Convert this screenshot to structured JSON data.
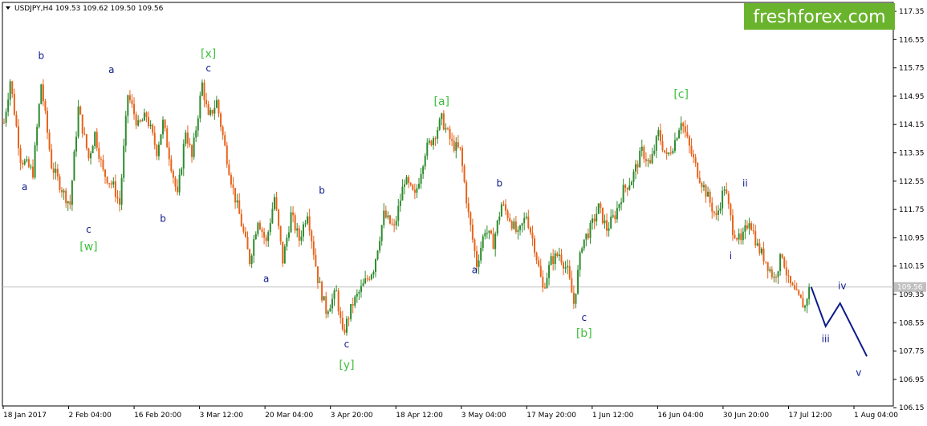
{
  "chart_data": {
    "type": "candlestick",
    "symbol_header": "USDJPY,H4  109.53 109.62 109.50 109.56",
    "current_price": 109.56,
    "current_price_label": "109.56",
    "ylim": [
      106.2,
      117.6
    ],
    "y_ticks": [
      "117.35",
      "116.55",
      "115.75",
      "114.95",
      "114.15",
      "113.35",
      "112.55",
      "111.75",
      "110.95",
      "110.15",
      "109.35",
      "108.55",
      "107.75",
      "106.95",
      "106.15"
    ],
    "x_ticks": [
      "18 Jan 2017",
      "2 Feb 04:00",
      "16 Feb 20:00",
      "3 Mar 12:00",
      "20 Mar 04:00",
      "3 Apr 20:00",
      "18 Apr 12:00",
      "3 May 04:00",
      "17 May 20:00",
      "1 Jun 12:00",
      "16 Jun 04:00",
      "30 Jun 20:00",
      "17 Jul 12:00",
      "1 Aug 04:00"
    ],
    "colors": {
      "up": "#2e8b2e",
      "down": "#e8631a",
      "wave_blue": "#0d1a8a",
      "wave_green": "#3fbf3f",
      "price_line": "#c0c0c0",
      "logo_bg": "#6ab42d"
    },
    "price_path": [
      [
        0,
        114.2
      ],
      [
        3,
        115.4
      ],
      [
        8,
        113.2
      ],
      [
        14,
        112.8
      ],
      [
        18,
        115.3
      ],
      [
        23,
        113.0
      ],
      [
        29,
        112.2
      ],
      [
        32,
        111.9
      ],
      [
        36,
        114.6
      ],
      [
        41,
        113.2
      ],
      [
        44,
        113.9
      ],
      [
        48,
        112.8
      ],
      [
        53,
        112.4
      ],
      [
        56,
        111.9
      ],
      [
        60,
        115.0
      ],
      [
        65,
        114.1
      ],
      [
        69,
        114.4
      ],
      [
        74,
        113.4
      ],
      [
        77,
        114.2
      ],
      [
        81,
        113.0
      ],
      [
        84,
        112.1
      ],
      [
        88,
        114.0
      ],
      [
        91,
        113.2
      ],
      [
        96,
        115.3
      ],
      [
        99,
        114.3
      ],
      [
        103,
        114.8
      ],
      [
        107,
        113.5
      ],
      [
        111,
        112.3
      ],
      [
        114,
        111.6
      ],
      [
        119,
        110.3
      ],
      [
        123,
        111.5
      ],
      [
        127,
        110.8
      ],
      [
        131,
        112.1
      ],
      [
        135,
        110.3
      ],
      [
        139,
        111.6
      ],
      [
        143,
        110.9
      ],
      [
        147,
        111.7
      ],
      [
        152,
        109.8
      ],
      [
        156,
        108.9
      ],
      [
        161,
        109.4
      ],
      [
        164,
        108.2
      ],
      [
        169,
        109.1
      ],
      [
        174,
        109.6
      ],
      [
        179,
        110.1
      ],
      [
        184,
        111.6
      ],
      [
        189,
        111.2
      ],
      [
        194,
        112.6
      ],
      [
        199,
        112.1
      ],
      [
        204,
        113.4
      ],
      [
        208,
        113.8
      ],
      [
        212,
        114.3
      ],
      [
        217,
        113.6
      ],
      [
        221,
        113.4
      ],
      [
        225,
        111.6
      ],
      [
        229,
        110.2
      ],
      [
        233,
        111.2
      ],
      [
        237,
        110.8
      ],
      [
        241,
        111.9
      ],
      [
        245,
        111.5
      ],
      [
        249,
        111.0
      ],
      [
        253,
        111.6
      ],
      [
        257,
        110.7
      ],
      [
        261,
        109.5
      ],
      [
        265,
        110.3
      ],
      [
        269,
        110.5
      ],
      [
        273,
        110.0
      ],
      [
        276,
        109.1
      ],
      [
        280,
        110.8
      ],
      [
        284,
        111.2
      ],
      [
        288,
        111.8
      ],
      [
        292,
        111.2
      ],
      [
        296,
        111.6
      ],
      [
        300,
        112.3
      ],
      [
        304,
        112.6
      ],
      [
        309,
        113.4
      ],
      [
        313,
        113.0
      ],
      [
        317,
        113.9
      ],
      [
        321,
        113.2
      ],
      [
        325,
        113.7
      ],
      [
        328,
        114.3
      ],
      [
        332,
        113.5
      ],
      [
        336,
        112.8
      ],
      [
        341,
        112.1
      ],
      [
        345,
        111.5
      ],
      [
        349,
        112.4
      ],
      [
        353,
        111.2
      ],
      [
        357,
        110.8
      ],
      [
        361,
        111.5
      ],
      [
        365,
        110.7
      ],
      [
        369,
        110.3
      ],
      [
        373,
        109.8
      ],
      [
        377,
        110.5
      ],
      [
        380,
        109.7
      ],
      [
        384,
        109.3
      ],
      [
        388,
        109.0
      ],
      [
        390,
        109.6
      ]
    ],
    "forecast": [
      [
        391,
        109.56
      ],
      [
        398,
        108.45
      ],
      [
        405,
        109.1
      ],
      [
        418,
        107.6
      ]
    ],
    "wave_labels": [
      {
        "text": "b",
        "x": 18,
        "price": 116.0,
        "color": "blue"
      },
      {
        "text": "a",
        "x": 10,
        "price": 112.3,
        "color": "blue"
      },
      {
        "text": "a",
        "x": 52,
        "price": 115.6,
        "color": "blue"
      },
      {
        "text": "c",
        "x": 41,
        "price": 111.1,
        "color": "blue"
      },
      {
        "text": "[w]",
        "x": 41,
        "price": 110.6,
        "color": "green"
      },
      {
        "text": "b",
        "x": 77,
        "price": 111.4,
        "color": "blue"
      },
      {
        "text": "[x]",
        "x": 99,
        "price": 116.05,
        "color": "green"
      },
      {
        "text": "c",
        "x": 99,
        "price": 115.65,
        "color": "blue"
      },
      {
        "text": "a",
        "x": 127,
        "price": 109.7,
        "color": "blue"
      },
      {
        "text": "b",
        "x": 154,
        "price": 112.2,
        "color": "blue"
      },
      {
        "text": "c",
        "x": 166,
        "price": 107.85,
        "color": "blue"
      },
      {
        "text": "[y]",
        "x": 166,
        "price": 107.25,
        "color": "green"
      },
      {
        "text": "[a]",
        "x": 212,
        "price": 114.7,
        "color": "green"
      },
      {
        "text": "b",
        "x": 240,
        "price": 112.4,
        "color": "blue"
      },
      {
        "text": "a",
        "x": 228,
        "price": 109.95,
        "color": "blue"
      },
      {
        "text": "c",
        "x": 281,
        "price": 108.6,
        "color": "blue"
      },
      {
        "text": "[b]",
        "x": 281,
        "price": 108.15,
        "color": "green"
      },
      {
        "text": "[c]",
        "x": 328,
        "price": 114.9,
        "color": "green"
      },
      {
        "text": "ii",
        "x": 359,
        "price": 112.4,
        "color": "blue"
      },
      {
        "text": "i",
        "x": 352,
        "price": 110.35,
        "color": "blue"
      },
      {
        "text": "iii",
        "x": 398,
        "price": 108.0,
        "color": "blue"
      },
      {
        "text": "iv",
        "x": 406,
        "price": 109.5,
        "color": "blue"
      },
      {
        "text": "v",
        "x": 414,
        "price": 107.05,
        "color": "blue"
      }
    ],
    "logo": "freshforex.com"
  }
}
